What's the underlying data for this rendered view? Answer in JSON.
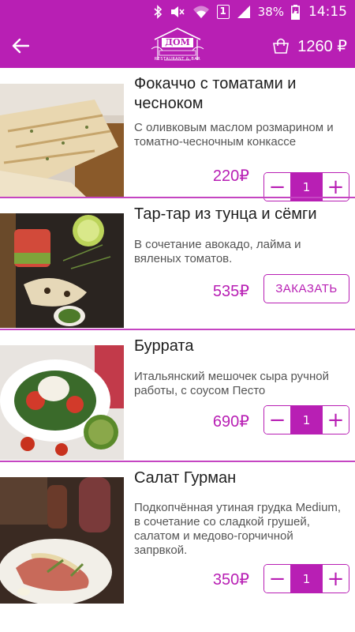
{
  "colors": {
    "accent": "#b81fb4",
    "separator": "#c545c2"
  },
  "status_bar": {
    "battery": "38%",
    "time": "14:15",
    "sim": "1"
  },
  "toolbar": {
    "logo_text": "ДОМ",
    "logo_sub": "RESTAURANT & BAR",
    "cart_total": "1260 ₽"
  },
  "items": [
    {
      "title": "Фокаччо с томатами и чесноком",
      "description": "С оливковым маслом розмарином и томатно-чесночным конкассе",
      "price": "220₽",
      "quantity": "1",
      "minus": "−",
      "plus": "+"
    },
    {
      "title": "Тар-тар из тунца и сёмги",
      "description": "В сочетание авокадо, лайма и вяленых томатов.",
      "price": "535₽",
      "order_label": "ЗАКАЗАТЬ"
    },
    {
      "title": "Буррата",
      "description": "Итальянский мешочек сыра ручной работы, с соусом Песто",
      "price": "690₽",
      "quantity": "1",
      "minus": "−",
      "plus": "+"
    },
    {
      "title": "Салат Гурман",
      "description": "Подкопчённая утиная грудка Medium, в сочетание со сладкой грушей, салатом и медово-горчичной запрвкой.",
      "price": "350₽",
      "quantity": "1",
      "minus": "−",
      "plus": "+"
    }
  ]
}
